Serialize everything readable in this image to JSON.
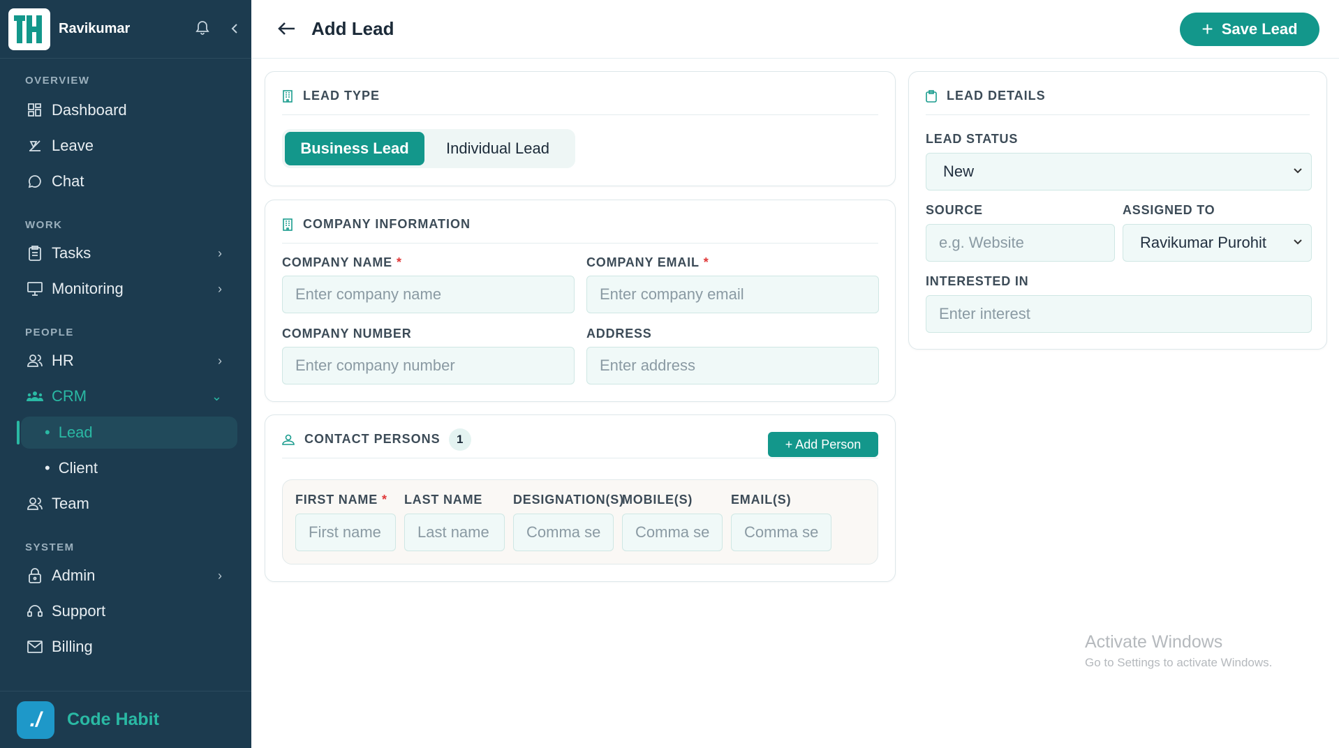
{
  "sidebar": {
    "username": "Ravikumar",
    "sections": {
      "overview": "OVERVIEW",
      "work": "WORK",
      "people": "PEOPLE",
      "system": "SYSTEM"
    },
    "items": {
      "dashboard": "Dashboard",
      "leave": "Leave",
      "chat": "Chat",
      "tasks": "Tasks",
      "monitoring": "Monitoring",
      "hr": "HR",
      "crm": "CRM",
      "lead": "Lead",
      "client": "Client",
      "team": "Team",
      "admin": "Admin",
      "support": "Support",
      "billing": "Billing"
    },
    "brand": "Code Habit"
  },
  "header": {
    "title": "Add Lead",
    "save_label": "Save Lead"
  },
  "lead_type": {
    "title": "LEAD TYPE",
    "options": [
      "Business Lead",
      "Individual Lead"
    ],
    "selected": "Business Lead"
  },
  "company": {
    "title": "COMPANY INFORMATION",
    "name_label": "COMPANY NAME",
    "name_placeholder": "Enter company name",
    "email_label": "COMPANY EMAIL",
    "email_placeholder": "Enter company email",
    "number_label": "COMPANY NUMBER",
    "number_placeholder": "Enter company number",
    "address_label": "ADDRESS",
    "address_placeholder": "Enter address"
  },
  "contacts": {
    "title": "CONTACT PERSONS",
    "count": "1",
    "add_label": "+ Add Person",
    "columns": [
      "FIRST NAME",
      "LAST NAME",
      "DESIGNATION(S)",
      "MOBILE(S)",
      "EMAIL(S)"
    ],
    "placeholders": [
      "First name",
      "Last name",
      "Comma se",
      "Comma se",
      "Comma se"
    ]
  },
  "lead_details": {
    "title": "LEAD DETAILS",
    "status_label": "LEAD STATUS",
    "status_value": "New",
    "source_label": "SOURCE",
    "source_placeholder": "e.g. Website",
    "assigned_label": "ASSIGNED TO",
    "assigned_value": "Ravikumar Purohit",
    "interest_label": "INTERESTED IN",
    "interest_placeholder": "Enter interest"
  },
  "watermark": {
    "line1": "Activate Windows",
    "line2": "Go to Settings to activate Windows."
  },
  "colors": {
    "sidebar_bg": "#1c3b4f",
    "accent": "#13978b",
    "accent_text": "#2ab9a4"
  }
}
